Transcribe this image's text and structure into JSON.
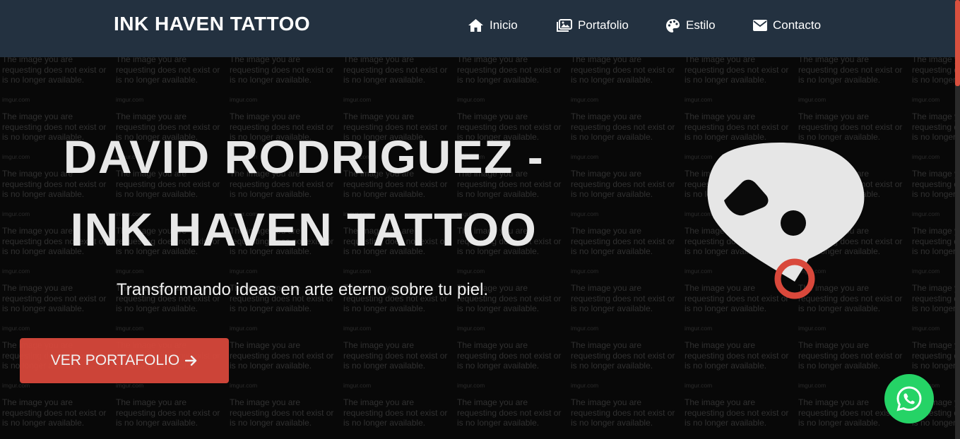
{
  "navbar": {
    "brand": "INK HAVEN TATTOO",
    "items": [
      {
        "label": "Inicio",
        "icon": "home-icon"
      },
      {
        "label": "Portafolio",
        "icon": "images-icon"
      },
      {
        "label": "Estilo",
        "icon": "palette-icon"
      },
      {
        "label": "Contacto",
        "icon": "envelope-icon"
      }
    ]
  },
  "hero": {
    "title_line1": "DAVID RODRIGUEZ -",
    "title_line2": "INK HAVEN TATTOO",
    "subtitle": "Transformando ideas en arte eterno sobre tu piel.",
    "cta_label": "VER PORTAFOLIO",
    "cta_icon": "arrow-right-icon",
    "placeholder_text": "The image you are requesting does not exist or is no longer available.",
    "placeholder_source": "imgur.com"
  },
  "whatsapp": {
    "icon": "whatsapp-icon"
  },
  "colors": {
    "navbar_bg": "#233140",
    "accent": "#d9483b",
    "whatsapp": "#25d366",
    "scroll_thumb": "#d9503f"
  }
}
